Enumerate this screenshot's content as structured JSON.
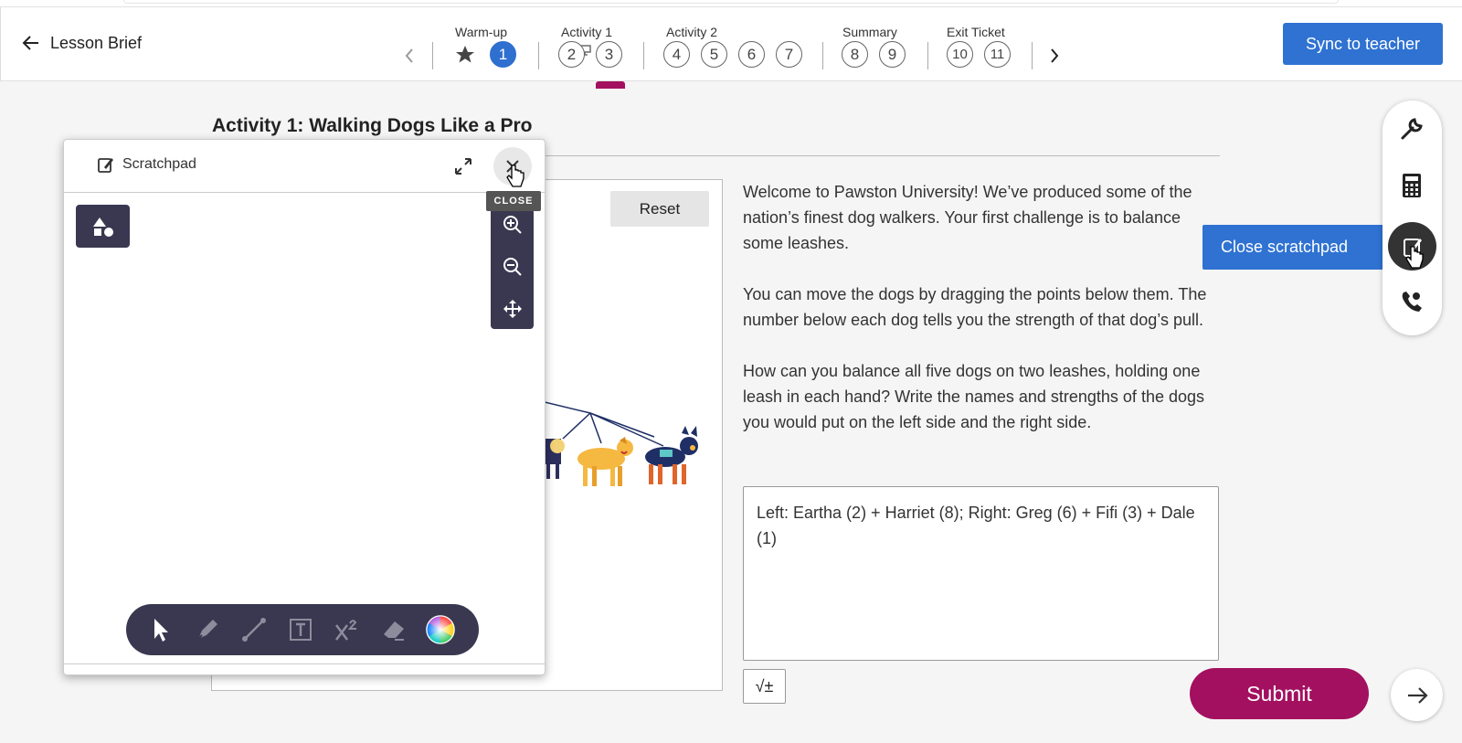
{
  "header": {
    "back_label": "Lesson Brief",
    "groups": [
      {
        "label": "Warm-up"
      },
      {
        "label": "Activity 1"
      },
      {
        "label": "Activity 2"
      },
      {
        "label": "Summary"
      },
      {
        "label": "Exit Ticket"
      }
    ],
    "steps": [
      "1",
      "2",
      "3",
      "4",
      "5",
      "6",
      "7",
      "8",
      "9",
      "10",
      "11"
    ],
    "active_step": "1",
    "current_step": "3",
    "sync_label": "Sync to teacher"
  },
  "main": {
    "activity_title": "Activity 1: Walking Dogs Like a Pro",
    "reset_label": "Reset",
    "instructions": [
      "Welcome to Pawston University! We’ve produced some of the nation’s finest dog walkers. Your first challenge is to balance some leashes.",
      "You can move the dogs by dragging the points below them. The number below each dog tells you the strength of that dog’s pull.",
      "How can you balance all five dogs on two leashes, holding one leash in each hand? Write the names and strengths of the dogs you would put on the left side and the right side."
    ],
    "answer_value": "Left: Eartha (2) + Harriet (8); Right: Greg (6) + Fifi (3) + Dale (1)",
    "math_button_label": "√±",
    "submit_label": "Submit"
  },
  "scratchpad": {
    "title": "Scratchpad",
    "close_tooltip": "CLOSE",
    "tools": [
      "select",
      "pen",
      "line",
      "text",
      "exponent",
      "eraser",
      "color"
    ]
  },
  "tool_rail": {
    "tools": [
      "wrench-icon",
      "calculator-icon",
      "scratchpad-icon",
      "phone-icon"
    ],
    "tooltip": "Close scratchpad"
  },
  "colors": {
    "accent_blue": "#2f72d2",
    "active_step": "#2f6fcf",
    "submit": "#a3105f",
    "scratch_dark": "#3a3850"
  }
}
